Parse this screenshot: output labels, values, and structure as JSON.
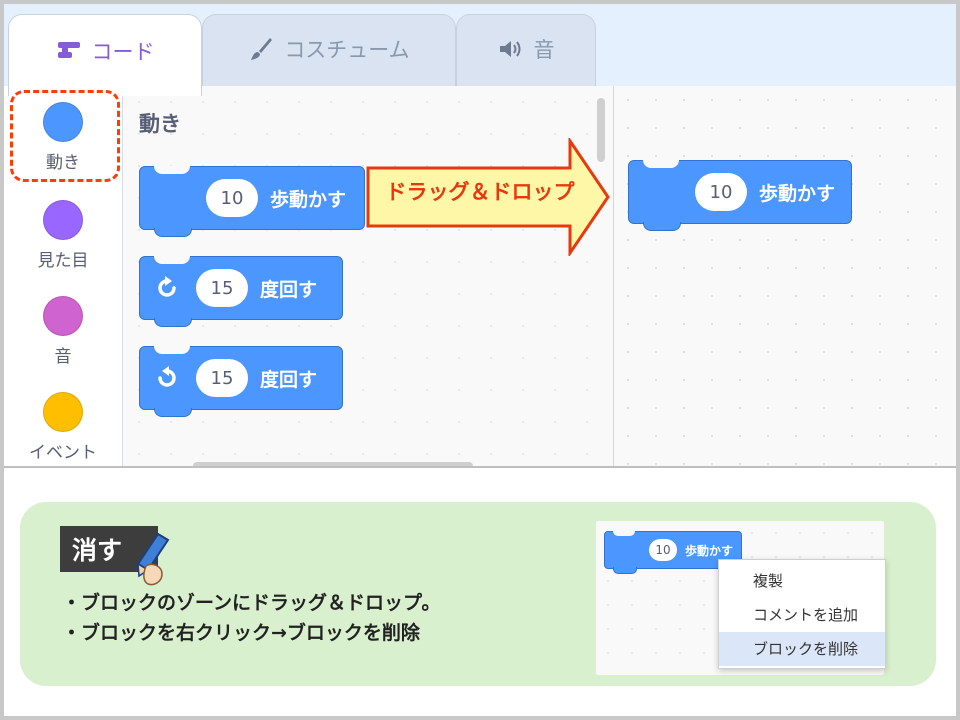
{
  "tabs": [
    {
      "label": "コード",
      "icon": "code-icon",
      "active": true
    },
    {
      "label": "コスチューム",
      "icon": "brush-icon",
      "active": false
    },
    {
      "label": "音",
      "icon": "speaker-icon",
      "active": false
    }
  ],
  "categories": [
    {
      "label": "動き",
      "color": "#4c97ff"
    },
    {
      "label": "見た目",
      "color": "#9966ff"
    },
    {
      "label": "音",
      "color": "#cf63cf"
    },
    {
      "label": "イベント",
      "color": "#ffbf00"
    }
  ],
  "palette": {
    "title": "動き",
    "blocks": [
      {
        "value": "10",
        "text": "歩動かす",
        "icon": ""
      },
      {
        "value": "15",
        "text": "度回す",
        "icon": "rotate-right-icon"
      },
      {
        "value": "15",
        "text": "度回す",
        "icon": "rotate-left-icon"
      }
    ]
  },
  "arrow_label": "ドラッグ＆ドロップ",
  "workspace": {
    "block": {
      "value": "10",
      "text": "歩動かす"
    }
  },
  "bottom": {
    "badge": "消す",
    "lines": [
      "・ブロックのゾーンにドラッグ＆ドロップ。",
      "・ブロックを右クリック→ブロックを削除"
    ],
    "screenshot": {
      "block": {
        "value": "10",
        "text": "歩動かす"
      },
      "menu": [
        "複製",
        "コメントを追加",
        "ブロックを削除"
      ]
    }
  },
  "colors": {
    "motion": "#4c97ff",
    "accent": "#855cd6",
    "highlight": "#ff3d00",
    "panel": "#d9f0cf"
  }
}
